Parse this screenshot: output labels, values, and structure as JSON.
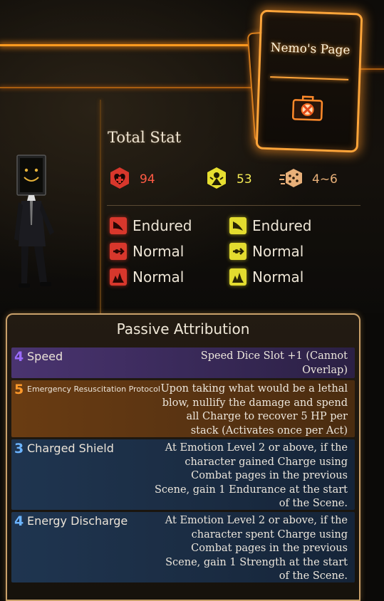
{
  "page_card": {
    "title": "Nemo's Page",
    "icon": "first-aid-kit-icon"
  },
  "total_stat": {
    "heading": "Total Stat",
    "hp": {
      "icon": "heart-plus-icon",
      "value": "94"
    },
    "stagger": {
      "icon": "stagger-resist-icon",
      "value": "53"
    },
    "speed": {
      "icon": "speed-dice-icon",
      "value": "4~6"
    }
  },
  "resistances": {
    "hp": [
      {
        "type": "slash",
        "icon": "slash-resist-icon",
        "label": "Endured"
      },
      {
        "type": "pierce",
        "icon": "pierce-resist-icon",
        "label": "Normal"
      },
      {
        "type": "blunt",
        "icon": "blunt-resist-icon",
        "label": "Normal"
      }
    ],
    "stagger": [
      {
        "type": "slash",
        "icon": "slash-resist-icon",
        "label": "Endured"
      },
      {
        "type": "pierce",
        "icon": "pierce-resist-icon",
        "label": "Normal"
      },
      {
        "type": "blunt",
        "icon": "blunt-resist-icon",
        "label": "Normal"
      }
    ]
  },
  "passive": {
    "title": "Passive Attribution",
    "items": [
      {
        "cost": "4",
        "name": "Speed",
        "desc_lines": [
          "Speed Dice Slot +1 (Cannot",
          "Overlap)"
        ],
        "color": "#9b6bff"
      },
      {
        "cost": "5",
        "name": "Emergency Resuscitation Protocol",
        "desc_lines": [
          "Upon taking what would be a lethal",
          "blow, nullify the damage and spend",
          "all Charge to recover 5 HP per",
          "stack (Activates once per Act)"
        ],
        "color": "#ff9a2a"
      },
      {
        "cost": "3",
        "name": "Charged Shield",
        "desc_lines": [
          "At Emotion Level 2 or above, if the",
          "character gained Charge using",
          "Combat pages in the previous",
          "Scene, gain 1 Endurance at the start",
          "of the Scene."
        ],
        "color": "#6cb4ff"
      },
      {
        "cost": "4",
        "name": "Energy Discharge",
        "desc_lines": [
          "At Emotion Level 2 or above, if the",
          "character spent Charge using",
          "Combat pages in the previous",
          "Scene, gain 1 Strength at the start",
          "of the Scene."
        ],
        "color": "#6cb4ff"
      }
    ]
  },
  "colors": {
    "accent": "#ffa53a",
    "hp_red": "#ff5a44",
    "stagger_yellow": "#f4ea55"
  }
}
